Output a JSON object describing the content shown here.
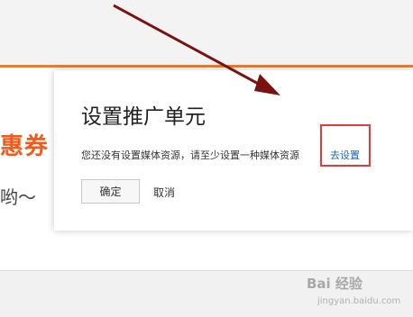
{
  "background": {
    "promo_text": "惠券",
    "sub_text": "哟～",
    "accent_color": "#f07c22"
  },
  "dialog": {
    "title": "设置推广单元",
    "message": "您还没有设置媒体资源，请至少设置一种媒体资源",
    "go_setting_label": "去设置",
    "ok_label": "确定",
    "cancel_label": "取消"
  },
  "annotation": {
    "arrow_color": "#7a1212",
    "highlight_color": "#e23b3b"
  },
  "watermark": {
    "text": "Bai 经验",
    "url": "jingyan.baidu.com"
  }
}
